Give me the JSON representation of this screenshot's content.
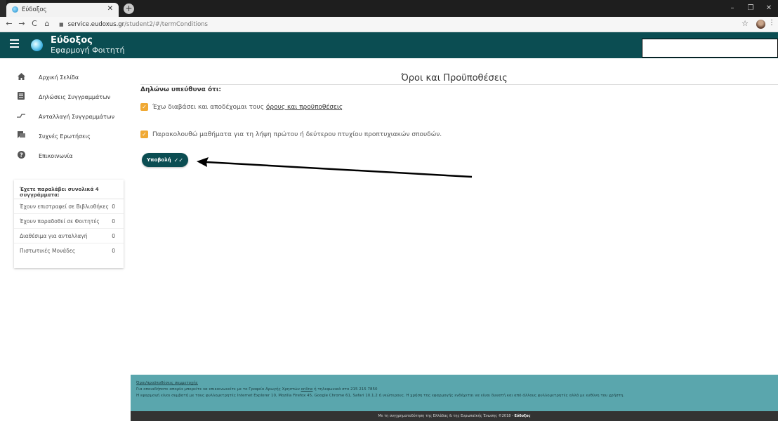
{
  "browser": {
    "tab_title": "Εύδοξος",
    "url_host": "service.eudoxus.gr",
    "url_path": "/student2/#/termConditions"
  },
  "header": {
    "app_name": "Εύδοξος",
    "app_subtitle": "Εφαρμογή Φοιτητή"
  },
  "sidebar": {
    "items": [
      {
        "label": "Αρχική Σελίδα",
        "icon": "home-icon"
      },
      {
        "label": "Δηλώσεις Συγγραμμάτων",
        "icon": "list-icon"
      },
      {
        "label": "Ανταλλαγή Συγγραμμάτων",
        "icon": "exchange-icon"
      },
      {
        "label": "Συχνές Ερωτήσεις",
        "icon": "chat-icon"
      },
      {
        "label": "Επικοινωνία",
        "icon": "help-icon"
      }
    ],
    "summary": {
      "title": "Έχετε παραλάβει συνολικά 4 συγγράμματα:",
      "rows": [
        {
          "label": "Έχουν επιστραφεί σε Βιβλιοθήκες",
          "value": "0"
        },
        {
          "label": "Έχουν παραδοθεί σε Φοιτητές",
          "value": "0"
        },
        {
          "label": "Διαθέσιμα για ανταλλαγή",
          "value": "0"
        },
        {
          "label": "Πιστωτικές Μονάδες",
          "value": "0"
        }
      ]
    }
  },
  "main": {
    "title": "Όροι και Προϋποθέσεις",
    "declaration": "Δηλώνω υπεύθυνα ότι:",
    "checkbox1_text": "Έχω διαβάσει και αποδέχομαι τους",
    "checkbox1_link": "όρους και προϋποθέσεις",
    "checkbox2_text": "Παρακολουθώ μαθήματα για τη λήψη πρώτου ή δεύτερου πτυχίου προπτυχιακών σπουδών.",
    "submit_label": "Υποβολή"
  },
  "footer": {
    "terms_link": "Όροι/προϋποθέσεις συμμετοχής",
    "contact_text": "Για οποιαδήποτε απορία μπορείτε να επικοινωνείτε με το Γραφείο Αρωγής Χρηστών",
    "contact_link": "online",
    "contact_phone": "ή τηλεφωνικά στο 215 215 7850",
    "compat_text": "Η εφαρμογή είναι συμβατή με τους φυλλομετρητές Internet Explorer 10, Mozilla Firefox 45, Google Chrome 61, Safari 10.1.2 ή νεώτερους. Η χρήση της εφαρμογής ενδέχεται να είναι δυνατή και από άλλους φυλλομετρητές αλλά με ευθύνη του χρήστη.",
    "funding_text": "Με τη συγχρηματοδότηση της Ελλάδας & της Ευρωπαϊκής Ένωσης ©2018 -",
    "funding_brand": "Εύδοξος"
  },
  "colors": {
    "primary": "#0b4d52",
    "checkbox": "#f0a934",
    "footer": "#5aa6ad"
  }
}
